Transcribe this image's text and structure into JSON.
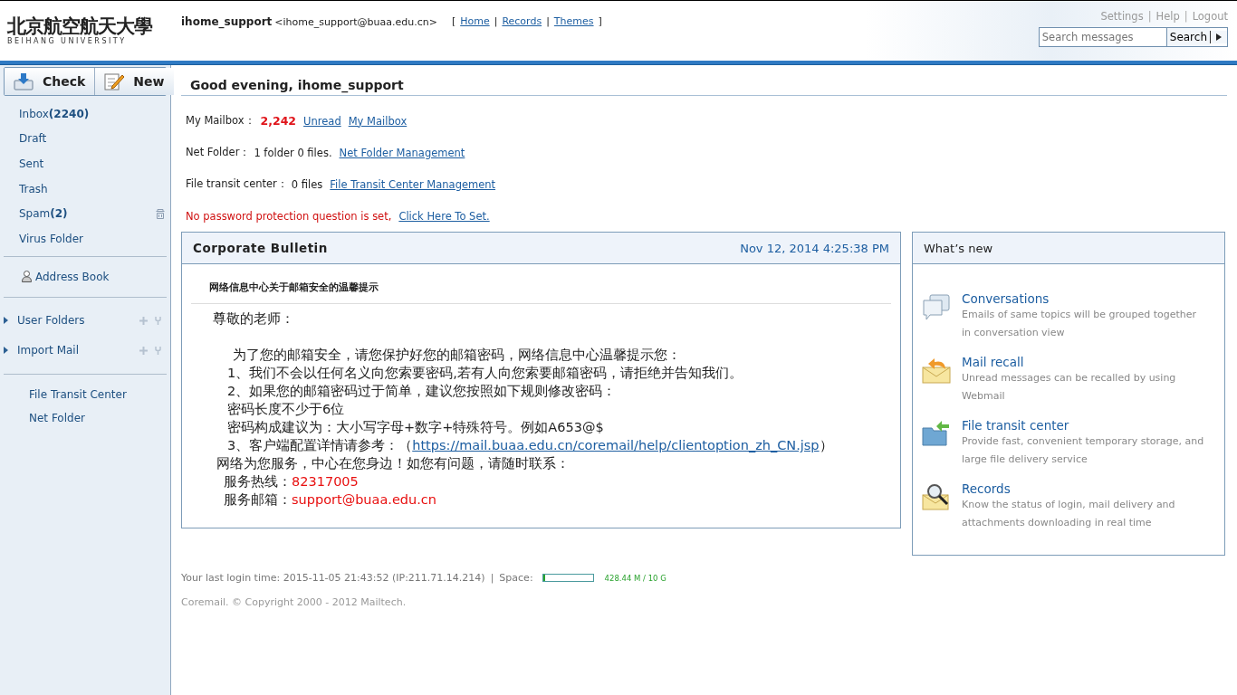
{
  "header": {
    "logo": {
      "name": "北京航空航天大學",
      "subtitle": "BEIHANG UNIVERSITY"
    },
    "user": {
      "name": "ihome_support",
      "email": "<ihome_support@buaa.edu.cn>"
    },
    "nav": {
      "open": "[",
      "separator": "|",
      "close": "]"
    },
    "nav_links": [
      {
        "label": "Home"
      },
      {
        "label": "Records "
      },
      {
        "label": "Themes"
      }
    ],
    "top_links": [
      "Settings",
      "Help",
      "Logout"
    ],
    "top_separator": "|",
    "search": {
      "placeholder": "Search messages",
      "button": "Search"
    }
  },
  "toolbar": [
    {
      "label": "Check",
      "kind": "check"
    },
    {
      "label": "New",
      "kind": "compose"
    }
  ],
  "sidebar": {
    "folders": [
      {
        "name": "Inbox",
        "count": "(2240)"
      },
      {
        "name": "Draft"
      },
      {
        "name": "Sent"
      },
      {
        "name": "Trash"
      },
      {
        "name": "Spam",
        "count": "(2)",
        "kind": "spam"
      },
      {
        "name": "Virus Folder"
      }
    ],
    "address_book": "Address Book",
    "groups": [
      {
        "label": "User Folders",
        "expanded": false
      },
      {
        "label": "Import Mail",
        "expanded": false
      }
    ],
    "tools": [
      "File Transit Center",
      "Net Folder"
    ]
  },
  "greeting": "Good evening, ihome_support",
  "summary": [
    {
      "label": "My Mailbox：",
      "count": "2,242",
      "links": [
        "Unread",
        "My Mailbox"
      ]
    },
    {
      "label": "Net Folder：",
      "text": "1 folder 0 files.",
      "links": [
        "Net Folder Management"
      ]
    },
    {
      "label": "File transit center：",
      "text": "0 files",
      "links": [
        "File Transit Center Management"
      ]
    }
  ],
  "warning": {
    "text": "No password protection question is set,",
    "link": "Click Here To Set."
  },
  "bulletin": {
    "title": "Corporate Bulletin",
    "date": "Nov 12, 2014 4:25:38 PM",
    "subject": "网络信息中心关于邮箱安全的温馨提示",
    "lines": [
      {
        "kind": "greeting",
        "text": "尊敬的老师："
      },
      {
        "kind": "blank"
      },
      {
        "kind": "intro",
        "text": "为了您的邮箱安全，请您保护好您的邮箱密码，网络信息中心温馨提示您："
      },
      {
        "kind": "item",
        "text": "1、我们不会以任何名义向您索要密码,若有人向您索要邮箱密码，请拒绝并告知我们。"
      },
      {
        "kind": "item",
        "text": "2、如果您的邮箱密码过于简单，建议您按照如下规则修改密码："
      },
      {
        "kind": "item",
        "text": "密码长度不少于6位"
      },
      {
        "kind": "item",
        "text": "密码构成建议为：大小写字母+数字+特殊符号。例如A653@$"
      },
      {
        "kind": "link",
        "text": "3、客户端配置详情请参考：（",
        "link": "https://mail.buaa.edu.cn/coremail/help/clientoption_zh_CN.jsp",
        "after": "）"
      },
      {
        "kind": "closing",
        "text": "网络为您服务，中心在您身边！如您有问题，请随时联系："
      },
      {
        "kind": "contact",
        "text": "服务热线：",
        "value": "82317005"
      },
      {
        "kind": "contact",
        "text": "服务邮箱：",
        "value": "support@buaa.edu.cn"
      }
    ]
  },
  "whats_new": {
    "title": "What’s new",
    "items": [
      {
        "kind": "conversations",
        "title": "Conversations",
        "desc": "Emails of same topics will be grouped together in conversation view"
      },
      {
        "kind": "recall",
        "title": "Mail recall",
        "desc": "Unread messages can be recalled by using Webmail"
      },
      {
        "kind": "transit",
        "title": "File transit center",
        "desc": "Provide fast, convenient temporary storage, and large file delivery service"
      },
      {
        "kind": "records",
        "title": "Records",
        "desc": "Know the status of login, mail delivery and attachments downloading in real time"
      }
    ]
  },
  "footer": {
    "login": "Your last login time: 2015-11-05 21:43:52 (IP:211.71.14.214)",
    "separator": "|",
    "space_label": "Space:",
    "space": {
      "level": 0.042
    },
    "space_reading": "428.44 M / 10 G",
    "copyright": "Coremail. © Copyright 2000 - 2012 Mailtech."
  }
}
